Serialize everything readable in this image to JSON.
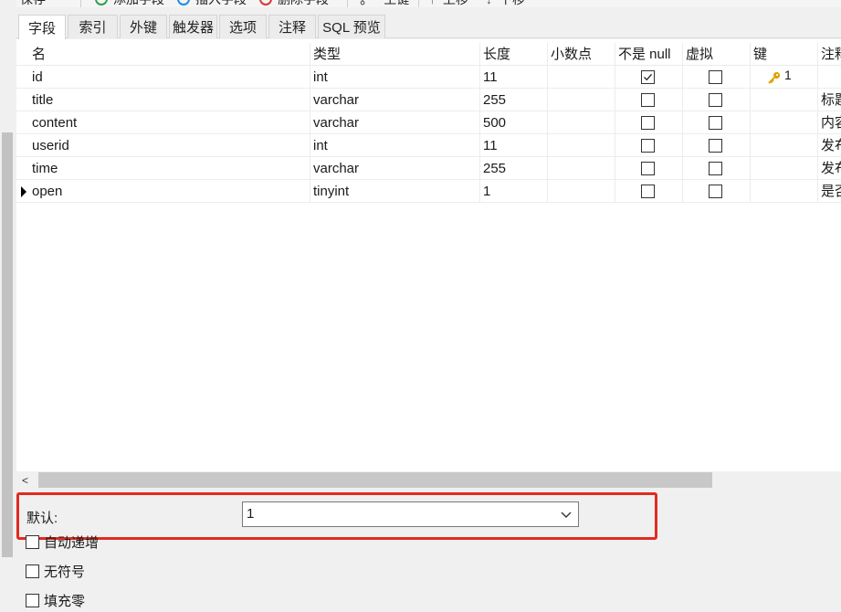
{
  "toolbar": {
    "save": "保存",
    "add_field": "添加字段",
    "insert_field": "插入字段",
    "delete_field": "删除字段",
    "primary_key": "主键",
    "move_up": "上移",
    "move_down": "下移"
  },
  "tabs": [
    "字段",
    "索引",
    "外键",
    "触发器",
    "选项",
    "注释",
    "SQL 预览"
  ],
  "columns": [
    "名",
    "类型",
    "长度",
    "小数点",
    "不是 null",
    "虚拟",
    "键",
    "注释"
  ],
  "rows": [
    {
      "name": "id",
      "type": "int",
      "length": "11",
      "decimals": "",
      "not_null": true,
      "virtual": false,
      "key": "1",
      "comment": ""
    },
    {
      "name": "title",
      "type": "varchar",
      "length": "255",
      "decimals": "",
      "not_null": false,
      "virtual": false,
      "key": "",
      "comment": "标题"
    },
    {
      "name": "content",
      "type": "varchar",
      "length": "500",
      "decimals": "",
      "not_null": false,
      "virtual": false,
      "key": "",
      "comment": "内容"
    },
    {
      "name": "userid",
      "type": "int",
      "length": "11",
      "decimals": "",
      "not_null": false,
      "virtual": false,
      "key": "",
      "comment": "发布"
    },
    {
      "name": "time",
      "type": "varchar",
      "length": "255",
      "decimals": "",
      "not_null": false,
      "virtual": false,
      "key": "",
      "comment": "发布"
    },
    {
      "name": "open",
      "type": "tinyint",
      "length": "1",
      "decimals": "",
      "not_null": false,
      "virtual": false,
      "key": "",
      "comment": "是否"
    }
  ],
  "selected_row": 5,
  "properties": {
    "default_label": "默认:",
    "default_value": "1",
    "options": [
      "自动递增",
      "无符号",
      "填充零"
    ]
  },
  "colors": {
    "highlight": "#e12b22",
    "key": "#e0a400",
    "add": "#2ea043",
    "insert": "#1e88e5",
    "delete": "#d9342b"
  }
}
